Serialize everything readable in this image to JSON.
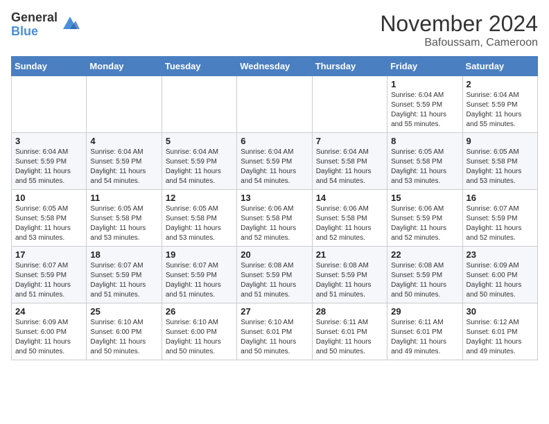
{
  "logo": {
    "general": "General",
    "blue": "Blue"
  },
  "header": {
    "month": "November 2024",
    "location": "Bafoussam, Cameroon"
  },
  "weekdays": [
    "Sunday",
    "Monday",
    "Tuesday",
    "Wednesday",
    "Thursday",
    "Friday",
    "Saturday"
  ],
  "weeks": [
    [
      {
        "day": "",
        "info": ""
      },
      {
        "day": "",
        "info": ""
      },
      {
        "day": "",
        "info": ""
      },
      {
        "day": "",
        "info": ""
      },
      {
        "day": "",
        "info": ""
      },
      {
        "day": "1",
        "info": "Sunrise: 6:04 AM\nSunset: 5:59 PM\nDaylight: 11 hours\nand 55 minutes."
      },
      {
        "day": "2",
        "info": "Sunrise: 6:04 AM\nSunset: 5:59 PM\nDaylight: 11 hours\nand 55 minutes."
      }
    ],
    [
      {
        "day": "3",
        "info": "Sunrise: 6:04 AM\nSunset: 5:59 PM\nDaylight: 11 hours\nand 55 minutes."
      },
      {
        "day": "4",
        "info": "Sunrise: 6:04 AM\nSunset: 5:59 PM\nDaylight: 11 hours\nand 54 minutes."
      },
      {
        "day": "5",
        "info": "Sunrise: 6:04 AM\nSunset: 5:59 PM\nDaylight: 11 hours\nand 54 minutes."
      },
      {
        "day": "6",
        "info": "Sunrise: 6:04 AM\nSunset: 5:59 PM\nDaylight: 11 hours\nand 54 minutes."
      },
      {
        "day": "7",
        "info": "Sunrise: 6:04 AM\nSunset: 5:58 PM\nDaylight: 11 hours\nand 54 minutes."
      },
      {
        "day": "8",
        "info": "Sunrise: 6:05 AM\nSunset: 5:58 PM\nDaylight: 11 hours\nand 53 minutes."
      },
      {
        "day": "9",
        "info": "Sunrise: 6:05 AM\nSunset: 5:58 PM\nDaylight: 11 hours\nand 53 minutes."
      }
    ],
    [
      {
        "day": "10",
        "info": "Sunrise: 6:05 AM\nSunset: 5:58 PM\nDaylight: 11 hours\nand 53 minutes."
      },
      {
        "day": "11",
        "info": "Sunrise: 6:05 AM\nSunset: 5:58 PM\nDaylight: 11 hours\nand 53 minutes."
      },
      {
        "day": "12",
        "info": "Sunrise: 6:05 AM\nSunset: 5:58 PM\nDaylight: 11 hours\nand 53 minutes."
      },
      {
        "day": "13",
        "info": "Sunrise: 6:06 AM\nSunset: 5:58 PM\nDaylight: 11 hours\nand 52 minutes."
      },
      {
        "day": "14",
        "info": "Sunrise: 6:06 AM\nSunset: 5:58 PM\nDaylight: 11 hours\nand 52 minutes."
      },
      {
        "day": "15",
        "info": "Sunrise: 6:06 AM\nSunset: 5:59 PM\nDaylight: 11 hours\nand 52 minutes."
      },
      {
        "day": "16",
        "info": "Sunrise: 6:07 AM\nSunset: 5:59 PM\nDaylight: 11 hours\nand 52 minutes."
      }
    ],
    [
      {
        "day": "17",
        "info": "Sunrise: 6:07 AM\nSunset: 5:59 PM\nDaylight: 11 hours\nand 51 minutes."
      },
      {
        "day": "18",
        "info": "Sunrise: 6:07 AM\nSunset: 5:59 PM\nDaylight: 11 hours\nand 51 minutes."
      },
      {
        "day": "19",
        "info": "Sunrise: 6:07 AM\nSunset: 5:59 PM\nDaylight: 11 hours\nand 51 minutes."
      },
      {
        "day": "20",
        "info": "Sunrise: 6:08 AM\nSunset: 5:59 PM\nDaylight: 11 hours\nand 51 minutes."
      },
      {
        "day": "21",
        "info": "Sunrise: 6:08 AM\nSunset: 5:59 PM\nDaylight: 11 hours\nand 51 minutes."
      },
      {
        "day": "22",
        "info": "Sunrise: 6:08 AM\nSunset: 5:59 PM\nDaylight: 11 hours\nand 50 minutes."
      },
      {
        "day": "23",
        "info": "Sunrise: 6:09 AM\nSunset: 6:00 PM\nDaylight: 11 hours\nand 50 minutes."
      }
    ],
    [
      {
        "day": "24",
        "info": "Sunrise: 6:09 AM\nSunset: 6:00 PM\nDaylight: 11 hours\nand 50 minutes."
      },
      {
        "day": "25",
        "info": "Sunrise: 6:10 AM\nSunset: 6:00 PM\nDaylight: 11 hours\nand 50 minutes."
      },
      {
        "day": "26",
        "info": "Sunrise: 6:10 AM\nSunset: 6:00 PM\nDaylight: 11 hours\nand 50 minutes."
      },
      {
        "day": "27",
        "info": "Sunrise: 6:10 AM\nSunset: 6:01 PM\nDaylight: 11 hours\nand 50 minutes."
      },
      {
        "day": "28",
        "info": "Sunrise: 6:11 AM\nSunset: 6:01 PM\nDaylight: 11 hours\nand 50 minutes."
      },
      {
        "day": "29",
        "info": "Sunrise: 6:11 AM\nSunset: 6:01 PM\nDaylight: 11 hours\nand 49 minutes."
      },
      {
        "day": "30",
        "info": "Sunrise: 6:12 AM\nSunset: 6:01 PM\nDaylight: 11 hours\nand 49 minutes."
      }
    ]
  ]
}
